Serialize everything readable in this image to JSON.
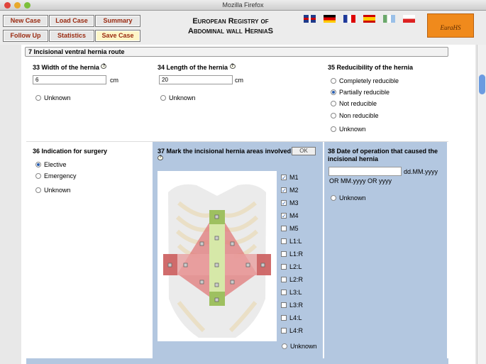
{
  "window": {
    "title": "Mozilla Firefox"
  },
  "nav": {
    "new_case": "New Case",
    "load_case": "Load Case",
    "summary": "Summary",
    "follow_up": "Follow Up",
    "statistics": "Statistics",
    "save_case": "Save Case"
  },
  "header": {
    "title_line1": "European Registry of",
    "title_line2": "Abdominal wall HerniaS",
    "logo_text": "EuraHS"
  },
  "flags": [
    "english",
    "german",
    "french",
    "spanish",
    "italian",
    "polish"
  ],
  "section": {
    "title": "7 Incisional ventral hernia route"
  },
  "q33": {
    "label": "33 Width of the hernia",
    "value": "6",
    "unit": "cm",
    "unknown": "Unknown"
  },
  "q34": {
    "label": "34 Length of the hernia",
    "value": "20",
    "unit": "cm",
    "unknown": "Unknown"
  },
  "q35": {
    "label": "35 Reducibility of the hernia",
    "options": [
      "Completely reducible",
      "Partially reducible",
      "Not reducible",
      "Non reducible",
      "Unknown"
    ],
    "selected": "Partially reducible"
  },
  "q36": {
    "label": "36 Indication for surgery",
    "options": [
      "Elective",
      "Emergency",
      "Unknown"
    ],
    "selected": "Elective"
  },
  "q37": {
    "label": "37 Mark the incisional hernia areas involved",
    "ok": "OK",
    "areas": [
      {
        "label": "M1",
        "checked": true
      },
      {
        "label": "M2",
        "checked": true
      },
      {
        "label": "M3",
        "checked": true
      },
      {
        "label": "M4",
        "checked": true
      },
      {
        "label": "M5",
        "checked": false
      },
      {
        "label": "L1:L",
        "checked": false
      },
      {
        "label": "L1:R",
        "checked": false
      },
      {
        "label": "L2:L",
        "checked": false
      },
      {
        "label": "L2:R",
        "checked": false
      },
      {
        "label": "L3:L",
        "checked": false
      },
      {
        "label": "L3:R",
        "checked": false
      },
      {
        "label": "L4:L",
        "checked": false
      },
      {
        "label": "L4:R",
        "checked": false
      }
    ],
    "unknown": "Unknown"
  },
  "q38": {
    "label": "38 Date of operation that caused the incisional hernia",
    "value": "",
    "format": "dd.MM.yyyy",
    "alt_format": "OR MM.yyyy OR yyyy",
    "unknown": "Unknown"
  }
}
